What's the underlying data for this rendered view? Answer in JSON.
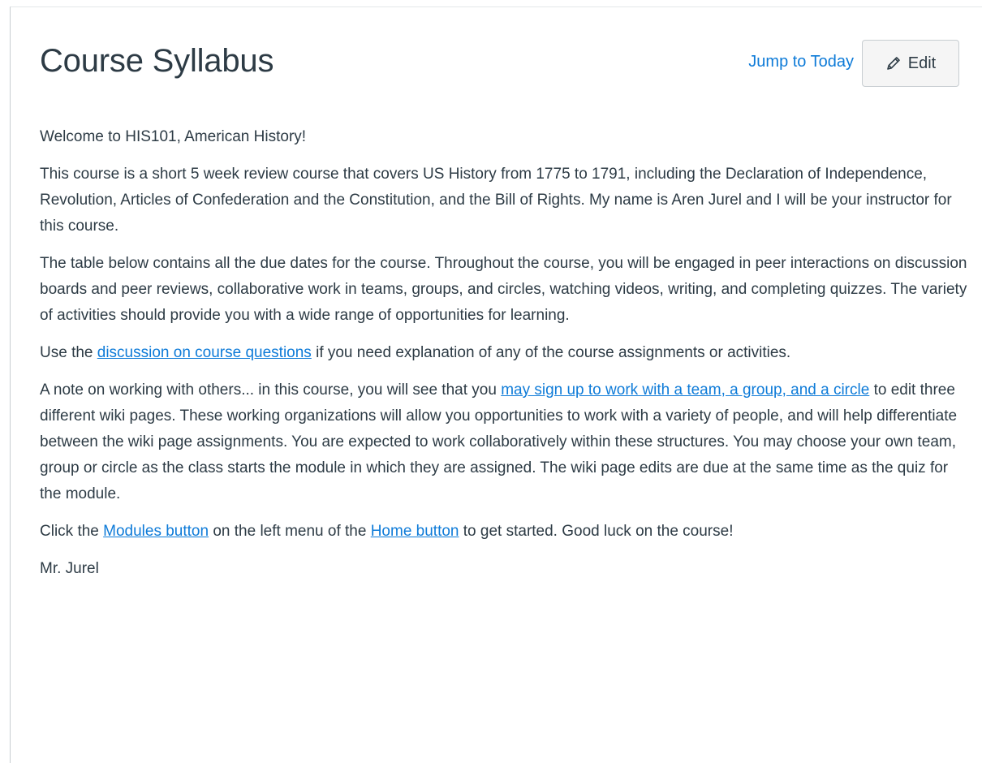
{
  "header": {
    "title": "Course Syllabus",
    "jump_to_today": "Jump to Today",
    "edit_label": "Edit",
    "edit_icon": "pencil-icon"
  },
  "content": {
    "welcome": "Welcome to HIS101, American History!",
    "intro": "This course is a short 5 week review course that covers US History from 1775 to 1791, including the Declaration of Independence, Revolution, Articles of Confederation and the Constitution, and the Bill of Rights. My name is Aren Jurel and I will be your instructor for this course.",
    "due_dates": "The table below contains all the due dates for the course. Throughout the course, you will be engaged in peer interactions on discussion boards and peer reviews, collaborative work in teams, groups, and circles, watching videos, writing, and completing quizzes. The variety of activities should provide you with a wide range of opportunities for learning.",
    "discussion": {
      "before": "Use the ",
      "link": "discussion on course questions",
      "after": " if you need explanation of any of the course assignments or activities."
    },
    "working": {
      "before": "A note on working with others... in this course, you will see that you ",
      "link": "may sign up to work with a team, a group, and a circle",
      "after": " to edit three different wiki pages. These working organizations will allow you opportunities to work with a variety of people, and will help differentiate between the wiki page assignments. You are expected to work collaboratively within these structures. You may choose your own team, group or circle as the class starts the module in which they are assigned. The wiki page edits are due at the same time as the quiz for the module."
    },
    "click": {
      "before": "Click the ",
      "modules_link": "Modules button",
      "middle": " on the left menu of the ",
      "home_link": "Home button",
      "after": " to get started. Good luck on the course!"
    },
    "signature": "Mr. Jurel"
  },
  "colors": {
    "text": "#2d3b45",
    "link": "#0e7bd8",
    "border": "#c7cdd1",
    "button_bg": "#f5f5f5"
  }
}
